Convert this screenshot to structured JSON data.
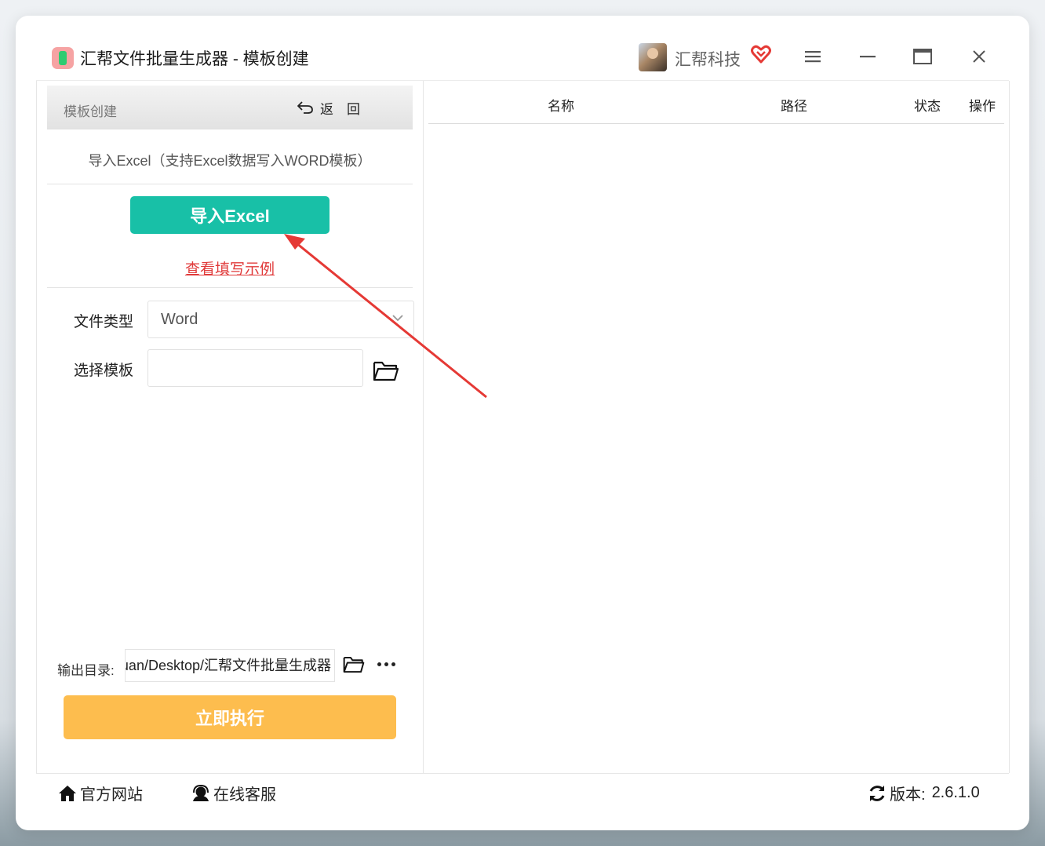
{
  "window": {
    "title": "汇帮文件批量生成器 - 模板创建",
    "brand_name": "汇帮科技"
  },
  "left_panel": {
    "header_title": "模板创建",
    "back_label": "返回",
    "hint": "导入Excel（支持Excel数据写入WORD模板）",
    "import_button": "导入Excel",
    "sample_link": "查看填写示例",
    "file_type_label": "文件类型",
    "file_type_value": "Word",
    "template_label": "选择模板",
    "template_value": "",
    "output_label": "输出目录:",
    "output_value": "uan/Desktop/汇帮文件批量生成器",
    "run_button": "立即执行"
  },
  "table": {
    "columns": [
      "名称",
      "路径",
      "状态",
      "操作"
    ],
    "rows": []
  },
  "footer": {
    "website": "官方网站",
    "support": "在线客服",
    "version_label": "版本:",
    "version_value": "2.6.1.0"
  },
  "colors": {
    "import_button": "#18c0a7",
    "run_button": "#fdbd4e",
    "sample_link": "#e03a3a",
    "annotation_arrow": "#e53935"
  },
  "icons": [
    "app-logo-icon",
    "vip-heart-icon",
    "menu-icon",
    "minimize-icon",
    "maximize-icon",
    "close-icon",
    "back-arrow-icon",
    "chevron-down-icon",
    "folder-icon",
    "more-icon",
    "home-icon",
    "support-icon",
    "refresh-icon"
  ]
}
